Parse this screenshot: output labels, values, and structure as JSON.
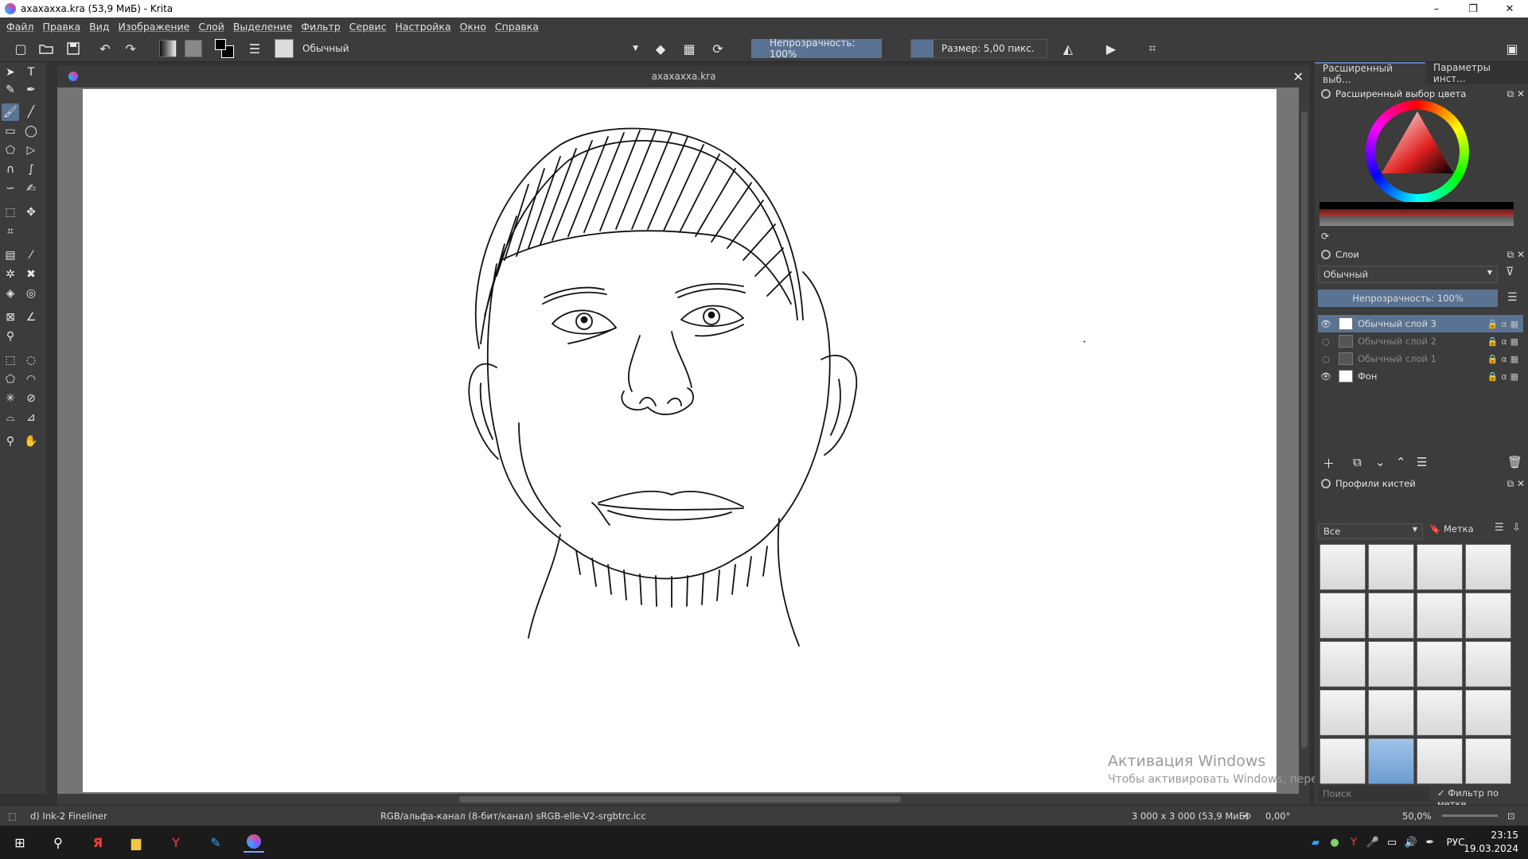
{
  "window": {
    "title": "axaxaxxa.kra (53,9 МиБ)  - Krita",
    "minimize": "–",
    "maximize": "❐",
    "close": "✕"
  },
  "menu": [
    "Файл",
    "Правка",
    "Вид",
    "Изображение",
    "Слой",
    "Выделение",
    "Фильтр",
    "Сервис",
    "Настройка",
    "Окно",
    "Справка"
  ],
  "toolbar": {
    "blend_mode": "Обычный",
    "opacity_label": "Непрозрачность: 100%",
    "size_label": "Размер: 5,00 пикс."
  },
  "document": {
    "tab_title": "axaxaxxa.kra",
    "watermark_title": "Активация Windows",
    "watermark_text": "Чтобы активировать Windows, перейдите в раздел «Параметры»."
  },
  "statusbar": {
    "brush": "d) Ink-2 Fineliner",
    "colorspace": "RGB/альфа-канал (8-бит/канал)  sRGB-elle-V2-srgbtrc.icc",
    "image_size": "3 000 x 3 000 (53,9 МиБ)",
    "rotation": "0,00°",
    "zoom": "50,0%"
  },
  "dock": {
    "tabs": [
      "Расширенный выб...",
      "Параметры инст..."
    ],
    "color_panel_title": "Расширенный выбор цвета",
    "layers_panel_title": "Слои",
    "layers_blend": "Обычный",
    "layers_opacity": "Непрозрачность:  100%",
    "layers": [
      {
        "name": "Обычный слой 3",
        "visible": true,
        "active": true
      },
      {
        "name": "Обычный слой 2",
        "visible": false,
        "active": false
      },
      {
        "name": "Обычный слой 1",
        "visible": false,
        "active": false
      },
      {
        "name": "Фон",
        "visible": true,
        "active": false
      }
    ],
    "brushes_panel_title": "Профили кистей",
    "brush_filter": "Все",
    "tag_label": "Метка",
    "search_placeholder": "Поиск",
    "filter_by_tag": "Фильтр по метке"
  },
  "taskbar": {
    "lang": "РУС",
    "time": "23:15",
    "date": "19.03.2024"
  },
  "colors": {
    "accent": "#5a7393",
    "panel": "#3c3c3c",
    "canvas_bg": "#757575"
  }
}
